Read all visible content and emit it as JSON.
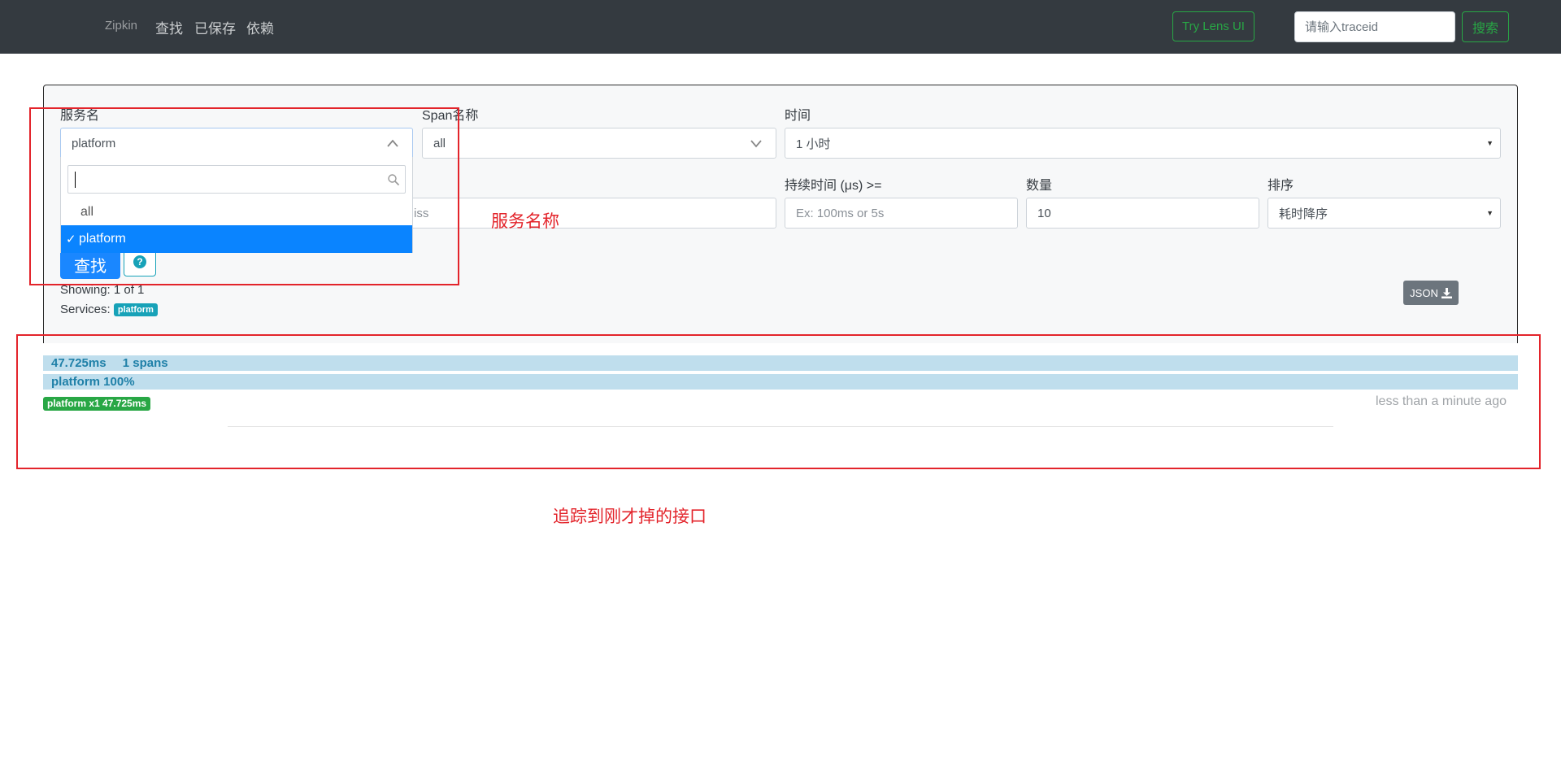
{
  "navbar": {
    "brand": "Zipkin",
    "links": [
      "查找",
      "已保存",
      "依赖"
    ],
    "lens_button": "Try Lens UI",
    "traceid_placeholder": "请输入traceid",
    "search_button": "搜索"
  },
  "form": {
    "service_label": "服务名",
    "service_value": "platform",
    "span_label": "Span名称",
    "span_value": "all",
    "time_label": "时间",
    "time_value": "1 小时",
    "annotation_placeholder_tail": "e.miss",
    "duration_label": "持续时间 (μs) >=",
    "duration_placeholder": "Ex: 100ms or 5s",
    "limit_label": "数量",
    "limit_value": "10",
    "sort_label": "排序",
    "sort_value": "耗时降序",
    "find_button": "查找",
    "help_icon_glyph": "?"
  },
  "service_dropdown": {
    "search_value": "",
    "options": [
      {
        "label": "all",
        "selected": false
      },
      {
        "label": "platform",
        "selected": true
      }
    ]
  },
  "results": {
    "showing": "Showing: 1 of 1",
    "services_label": "Services:",
    "services_badge": "platform",
    "json_button": "JSON"
  },
  "trace": {
    "duration": "47.725ms",
    "spans": "1 spans",
    "service_percent": "platform 100%",
    "service_badge": "platform x1 47.725ms",
    "timestamp": "less than a minute ago"
  },
  "annotations": {
    "label_service": "服务名称",
    "label_trace": "追踪到刚才掉的接口",
    "color": "#e3242b"
  },
  "colors": {
    "navbar_bg": "#343a40",
    "accent_green": "#28a745",
    "primary_blue": "#1a87ff",
    "info_teal": "#17a2b8",
    "trace_bar_bg": "#bfdeed"
  }
}
